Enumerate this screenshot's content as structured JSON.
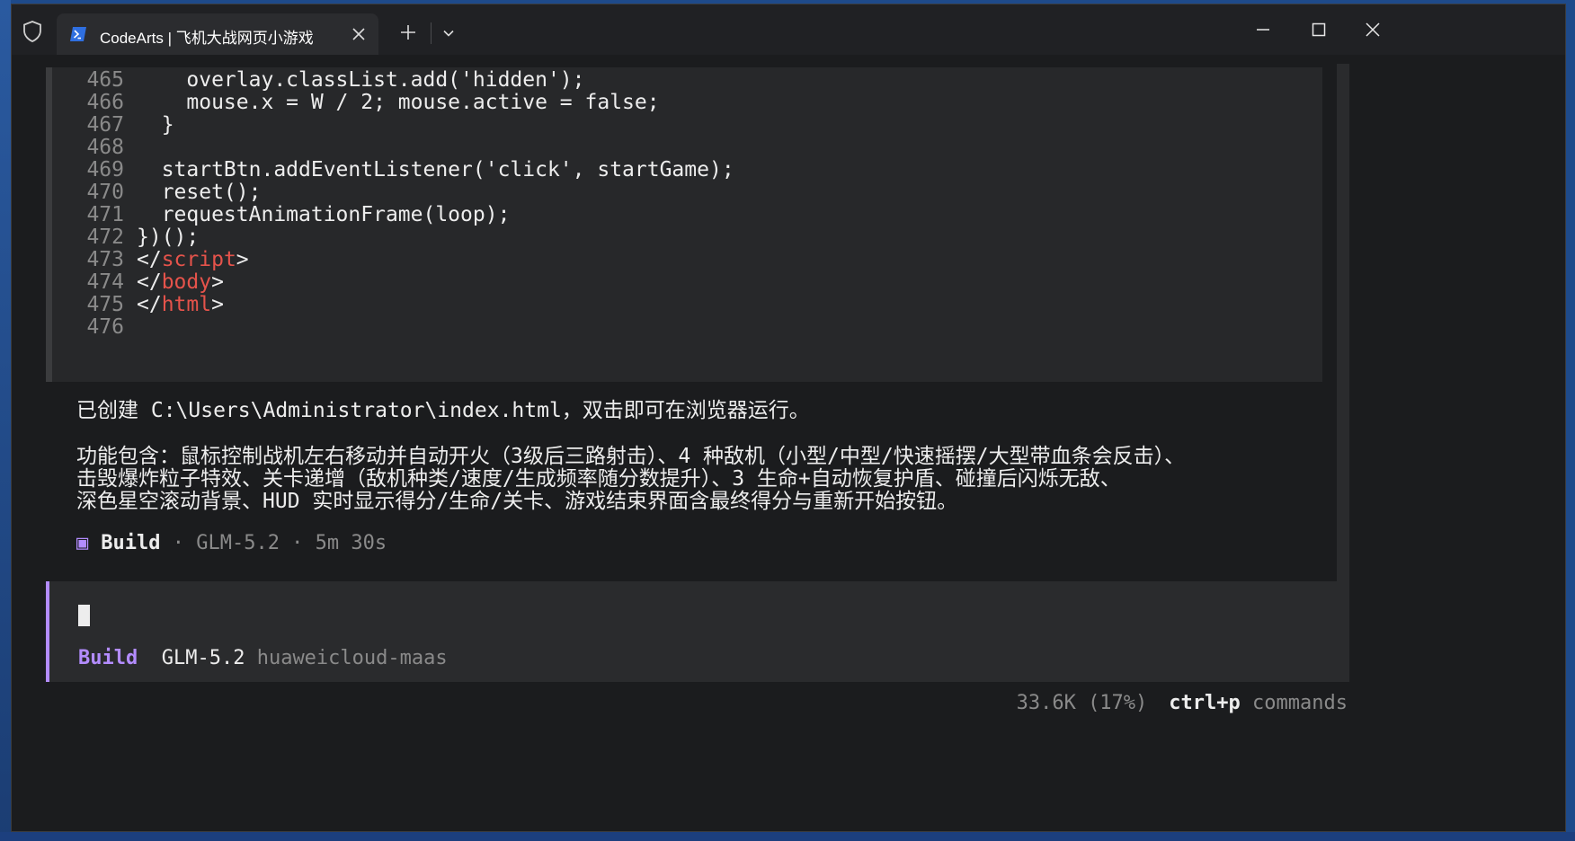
{
  "window": {
    "tab_title": "CodeArts | 飞机大战网页小游戏",
    "icons": {
      "shield": "shield-icon",
      "terminal": "powershell-icon",
      "close_tab": "close-icon",
      "new_tab": "plus-icon",
      "dropdown": "chevron-down-icon",
      "minimize": "minimize-icon",
      "maximize": "maximize-icon",
      "close": "close-icon"
    }
  },
  "code_lines": [
    {
      "num": "465",
      "text": "    overlay.classList.add('hidden');"
    },
    {
      "num": "466",
      "text": "    mouse.x = W / 2; mouse.active = false;"
    },
    {
      "num": "467",
      "text": "  }"
    },
    {
      "num": "468",
      "text": ""
    },
    {
      "num": "469",
      "text": "  startBtn.addEventListener('click', startGame);"
    },
    {
      "num": "470",
      "text": "  reset();"
    },
    {
      "num": "471",
      "text": "  requestAnimationFrame(loop);"
    },
    {
      "num": "472",
      "text": "})();"
    },
    {
      "num": "473",
      "pre": "</",
      "tag": "script",
      "post": ">"
    },
    {
      "num": "474",
      "pre": "</",
      "tag": "body",
      "post": ">"
    },
    {
      "num": "475",
      "pre": "</",
      "tag": "html",
      "post": ">"
    },
    {
      "num": "476",
      "text": ""
    }
  ],
  "message": {
    "line1": "已创建 C:\\Users\\Administrator\\index.html，双击即可在浏览器运行。",
    "line2": "功能包含：鼠标控制战机左右移动并自动开火（3级后三路射击）、4 种敌机（小型/中型/快速摇摆/大型带血条会反击）、",
    "line3": "击毁爆炸粒子特效、关卡递增（敌机种类/速度/生成频率随分数提升）、3 生命+自动恢复护盾、碰撞后闪烁无敌、",
    "line4": "深色星空滚动背景、HUD 实时显示得分/生命/关卡、游戏结束界面含最终得分与重新开始按钮。"
  },
  "build": {
    "icon": "▣",
    "agent": "Build",
    "meta": " · GLM-5.2 · 5m 30s"
  },
  "prompt": {
    "agent": "Build",
    "model": "GLM-5.2",
    "provider": "huaweicloud-maas"
  },
  "footer": {
    "usage": "33.6K (17%)",
    "key": "ctrl+p",
    "label": " commands"
  },
  "colors": {
    "accent": "#b38cff",
    "tag": "#e5534b",
    "background": "#1b1c1e"
  }
}
